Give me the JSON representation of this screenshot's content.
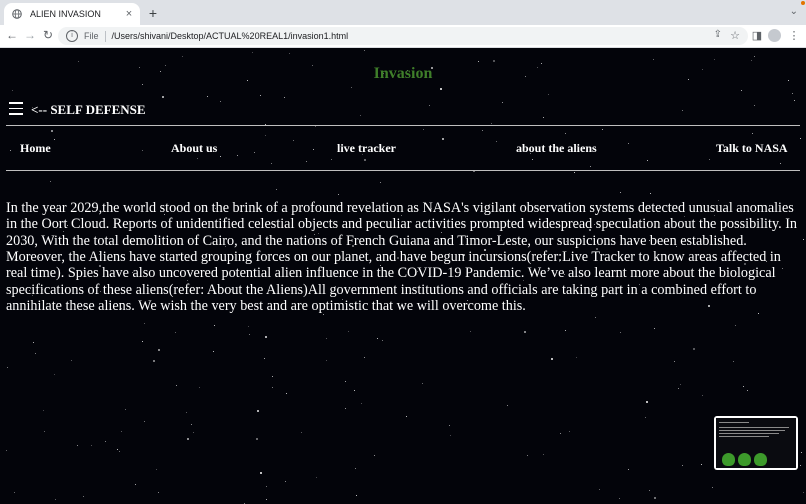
{
  "browser": {
    "tab_title": "ALIEN INVASION",
    "tab_close": "×",
    "new_tab": "+",
    "tab_menu": "⌄",
    "url_scheme_label": "File",
    "url": "/Users/shivani/Desktop/ACTUAL%20REAL1/invasion1.html",
    "back": "←",
    "forward": "→",
    "reload": "↻",
    "share": "⇪",
    "star": "☆",
    "sidebar": "◨",
    "more": "⋮"
  },
  "page": {
    "site_title": "Invasion",
    "self_defense": "<-- SELF DEFENSE",
    "nav": [
      "Home",
      "About us",
      "live tracker",
      "about the aliens",
      "Talk to NASA"
    ],
    "intro": "In the year 2029,the world stood on the brink of a profound revelation as NASA's vigilant observation systems detected unusual anomalies in the Oort Cloud. Reports of unidentified celestial objects and peculiar activities prompted widespread speculation about the possibility. In 2030, With the total demolition of Cairo, and the nations of French Guiana and Timor-Leste, our suspicions have been established. Moreover, the Aliens have started grouping forces on our planet, and have begun incursions(refer:Live Tracker to know areas affected in real time). Spies have also uncovered potential alien influence in the COVID-19 Pandemic. We’ve also learnt more about the biological specifications of these aliens(refer: About the Aliens)All government institutions and officials are taking part in a combined effort to annihilate these aliens. We wish the very best and are optimistic that we will overcome this."
  },
  "colors": {
    "title_green": "#3f7e2a",
    "background": "#03040a",
    "text": "#ffffff"
  },
  "icons": [
    "globe-icon",
    "close-icon",
    "plus-icon",
    "back-arrow-icon",
    "forward-arrow-icon",
    "reload-icon",
    "info-icon",
    "share-icon",
    "bookmark-star-icon",
    "sidebar-icon",
    "profile-icon",
    "more-menu-icon",
    "hamburger-menu-icon"
  ]
}
